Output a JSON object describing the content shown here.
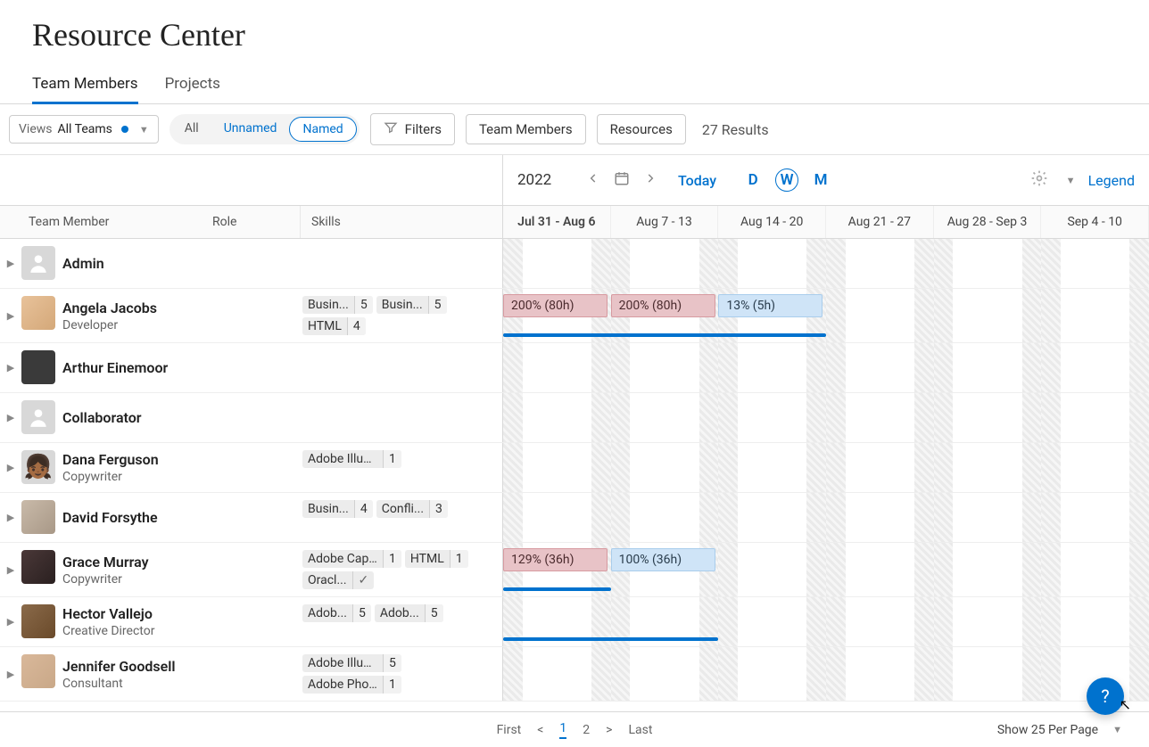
{
  "page": {
    "title": "Resource Center"
  },
  "tabs": {
    "team_members": "Team Members",
    "projects": "Projects"
  },
  "toolbar": {
    "views_label": "Views",
    "views_value": "All Teams",
    "pill_all": "All",
    "pill_unnamed": "Unnamed",
    "pill_named": "Named",
    "filters": "Filters",
    "team_members_btn": "Team Members",
    "resources_btn": "Resources",
    "results": "27 Results"
  },
  "timeline": {
    "year": "2022",
    "today": "Today",
    "d": "D",
    "w": "W",
    "m": "M",
    "legend": "Legend",
    "weeks": [
      "Jul 31 - Aug 6",
      "Aug 7 - 13",
      "Aug 14 - 20",
      "Aug 21 - 27",
      "Aug 28 - Sep 3",
      "Sep 4 - 10"
    ]
  },
  "columns": {
    "member": "Team Member",
    "role": "Role",
    "skills": "Skills"
  },
  "rows": [
    {
      "name": "Admin",
      "role": "",
      "avatar": "generic",
      "skills": [],
      "allocs": []
    },
    {
      "name": "Angela Jacobs",
      "role": "Developer",
      "avatar": "aj",
      "skills": [
        {
          "n": "Busin...",
          "l": "5"
        },
        {
          "n": "Busin...",
          "l": "5"
        },
        {
          "n": "HTML",
          "l": "4"
        }
      ],
      "allocs": [
        {
          "label": "200% (80h)",
          "type": "over",
          "start": 0,
          "span": 1
        },
        {
          "label": "200% (80h)",
          "type": "over",
          "start": 1,
          "span": 1
        },
        {
          "label": "13% (5h)",
          "type": "ok",
          "start": 2,
          "span": 1
        }
      ],
      "bar": {
        "start": 0,
        "span": 3
      }
    },
    {
      "name": "Arthur Einemoor",
      "role": "",
      "avatar": "ae",
      "skills": [],
      "allocs": []
    },
    {
      "name": "Collaborator",
      "role": "",
      "avatar": "generic",
      "skills": [],
      "allocs": []
    },
    {
      "name": "Dana Ferguson",
      "role": "Copywriter",
      "avatar": "df",
      "skills": [
        {
          "n": "Adobe Illustrator",
          "l": "1"
        }
      ],
      "allocs": []
    },
    {
      "name": "David Forsythe",
      "role": "",
      "avatar": "dfor",
      "skills": [
        {
          "n": "Busin...",
          "l": "4"
        },
        {
          "n": "Confli...",
          "l": "3"
        }
      ],
      "allocs": []
    },
    {
      "name": "Grace Murray",
      "role": "Copywriter",
      "avatar": "gm",
      "skills": [
        {
          "n": "Adobe Captivate",
          "l": "1"
        },
        {
          "n": "HTML",
          "l": "1"
        },
        {
          "n": "Oracl...",
          "l": "",
          "check": true
        }
      ],
      "allocs": [
        {
          "label": "129% (36h)",
          "type": "over",
          "start": 0,
          "span": 1
        },
        {
          "label": "100% (36h)",
          "type": "ok",
          "start": 1,
          "span": 1
        }
      ],
      "bar": {
        "start": 0,
        "span": 1
      }
    },
    {
      "name": "Hector Vallejo",
      "role": "Creative Director",
      "avatar": "hv",
      "skills": [
        {
          "n": "Adob...",
          "l": "5"
        },
        {
          "n": "Adob...",
          "l": "5"
        }
      ],
      "allocs": [],
      "bar": {
        "start": 0,
        "span": 2
      }
    },
    {
      "name": "Jennifer Goodsell",
      "role": "Consultant",
      "avatar": "jg",
      "skills": [
        {
          "n": "Adobe Illustrator",
          "l": "5"
        },
        {
          "n": "Adobe Photoshop",
          "l": "1"
        }
      ],
      "allocs": []
    }
  ],
  "pager": {
    "first": "First",
    "prev": "<",
    "p1": "1",
    "p2": "2",
    "next": ">",
    "last": "Last"
  },
  "perpage": "Show 25 Per Page"
}
